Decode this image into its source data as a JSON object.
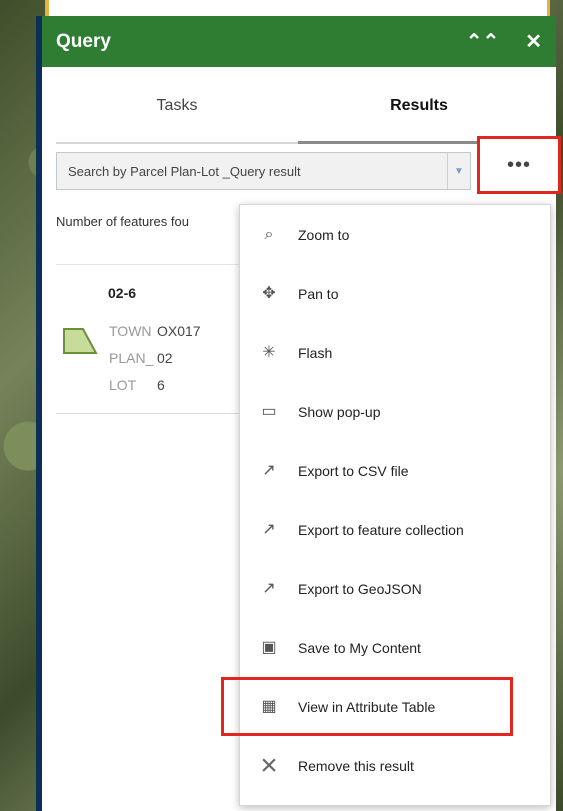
{
  "window": {
    "title": "Query",
    "collapse_icon": "double-chevron-up-icon",
    "close_icon": "close-icon"
  },
  "tabs": [
    {
      "label": "Tasks",
      "active": false
    },
    {
      "label": "Results",
      "active": true
    }
  ],
  "search": {
    "selected_value": "Search by Parcel Plan-Lot _Query result",
    "dropdown_icon": "chevron-down-icon"
  },
  "summary": {
    "feature_count_label": "Number of features fou"
  },
  "result": {
    "title": "02-6",
    "attributes": [
      {
        "label": "TOWN",
        "value": "OX017"
      },
      {
        "label": "PLAN_",
        "value": "02"
      },
      {
        "label": "LOT",
        "value": "6"
      }
    ]
  },
  "menu": {
    "more_label": "•••",
    "items": [
      {
        "label": "Zoom to",
        "icon": "zoom-to-icon"
      },
      {
        "label": "Pan to",
        "icon": "pan-to-icon"
      },
      {
        "label": "Flash",
        "icon": "flash-icon"
      },
      {
        "label": "Show pop-up",
        "icon": "popup-icon"
      },
      {
        "label": "Export to CSV file",
        "icon": "export-icon"
      },
      {
        "label": "Export to feature collection",
        "icon": "export-icon"
      },
      {
        "label": "Export to GeoJSON",
        "icon": "export-icon"
      },
      {
        "label": "Save to My Content",
        "icon": "save-icon"
      },
      {
        "label": "View in Attribute Table",
        "icon": "table-icon"
      },
      {
        "label": "Remove this result",
        "icon": "remove-icon"
      }
    ]
  },
  "colors": {
    "header": "#2f7d32",
    "highlight": "#e2261e",
    "parcel_fill": "#c7dc9a",
    "parcel_stroke": "#6b8f3a"
  }
}
